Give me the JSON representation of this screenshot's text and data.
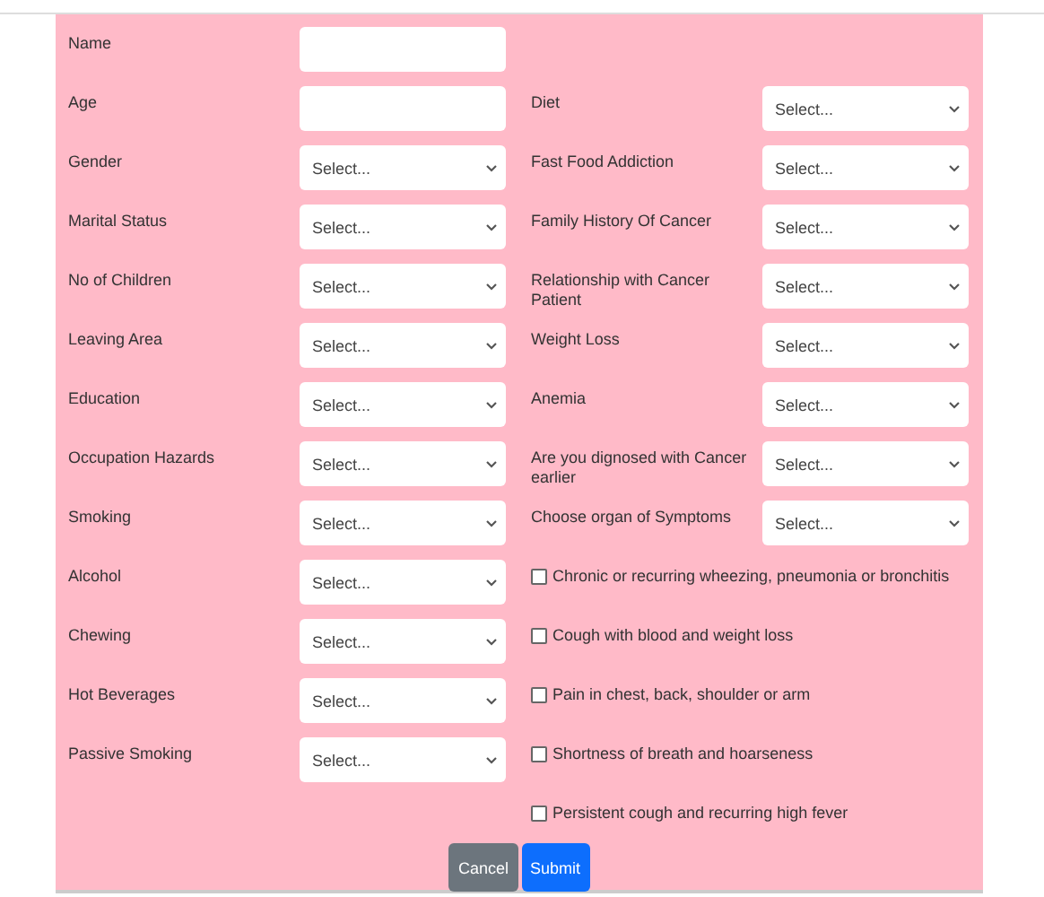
{
  "rows": [
    {
      "left": {
        "label": "Name",
        "kind": "input"
      }
    },
    {
      "left": {
        "label": "Age",
        "kind": "input"
      },
      "right": {
        "label": "Diet",
        "kind": "select",
        "value": "Select..."
      }
    },
    {
      "left": {
        "label": "Gender",
        "kind": "select",
        "value": "Select..."
      },
      "right": {
        "label": "Fast Food Addiction",
        "kind": "select",
        "value": "Select..."
      }
    },
    {
      "left": {
        "label": "Marital Status",
        "kind": "select",
        "value": "Select..."
      },
      "right": {
        "label": "Family History Of Cancer",
        "kind": "select",
        "value": "Select..."
      }
    },
    {
      "left": {
        "label": "No of Children",
        "kind": "select",
        "value": "Select..."
      },
      "right": {
        "label": "Relationship with Cancer Patient",
        "kind": "select",
        "value": "Select..."
      }
    },
    {
      "left": {
        "label": "Leaving Area",
        "kind": "select",
        "value": "Select..."
      },
      "right": {
        "label": "Weight Loss",
        "kind": "select",
        "value": "Select..."
      }
    },
    {
      "left": {
        "label": "Education",
        "kind": "select",
        "value": "Select..."
      },
      "right": {
        "label": "Anemia",
        "kind": "select",
        "value": "Select..."
      }
    },
    {
      "left": {
        "label": "Occupation Hazards",
        "kind": "select",
        "value": "Select..."
      },
      "right": {
        "label": "Are you dignosed with Cancer earlier",
        "kind": "select",
        "value": "Select..."
      }
    },
    {
      "left": {
        "label": "Smoking",
        "kind": "select",
        "value": "Select..."
      },
      "right": {
        "label": "Choose organ of Symptoms",
        "kind": "select",
        "value": "Select..."
      }
    },
    {
      "left": {
        "label": "Alcohol",
        "kind": "select",
        "value": "Select..."
      },
      "right": {
        "label": "Chronic or recurring wheezing, pneumonia or bronchitis",
        "kind": "checkbox",
        "checked": false
      }
    },
    {
      "left": {
        "label": "Chewing",
        "kind": "select",
        "value": "Select..."
      },
      "right": {
        "label": "Cough with blood and weight loss",
        "kind": "checkbox",
        "checked": false
      }
    },
    {
      "left": {
        "label": "Hot Beverages",
        "kind": "select",
        "value": "Select..."
      },
      "right": {
        "label": "Pain in chest, back, shoulder or arm",
        "kind": "checkbox",
        "checked": false
      }
    },
    {
      "left": {
        "label": "Passive Smoking",
        "kind": "select",
        "value": "Select..."
      },
      "right": {
        "label": "Shortness of breath and hoarseness",
        "kind": "checkbox",
        "checked": false
      }
    },
    {
      "right": {
        "label": "Persistent cough and recurring high fever",
        "kind": "checkbox",
        "checked": false
      }
    }
  ],
  "buttons": [
    {
      "label": "Cancel",
      "kind": "secondary"
    },
    {
      "label": "Submit",
      "kind": "primary"
    }
  ]
}
